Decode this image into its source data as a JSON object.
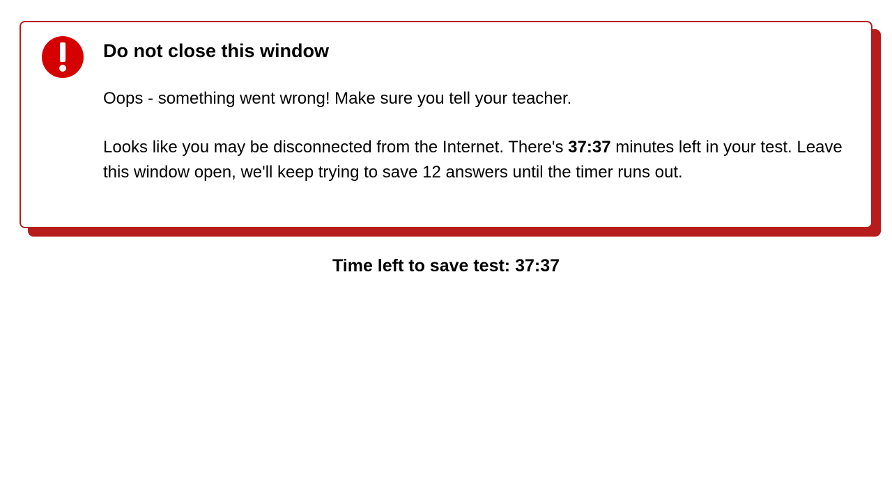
{
  "alert": {
    "title": "Do not close this window",
    "message": "Oops - something went wrong! Make sure you tell your teacher.",
    "details_before": "Looks like you may be disconnected from the Internet. There's ",
    "time_remaining": "37:37",
    "details_after_time": " minutes left in your test. Leave this window open, we'll keep trying to save 12 answers until the timer runs out.",
    "unsaved_answers": 12
  },
  "footer": {
    "label": "Time left to save test: ",
    "time": "37:37"
  }
}
